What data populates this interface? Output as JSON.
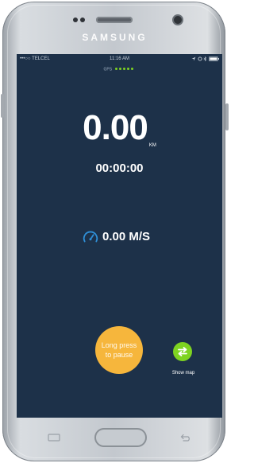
{
  "device": {
    "brand": "SAMSUNG"
  },
  "status_bar": {
    "carrier": "•••○○ TELCEL",
    "time": "11:16 AM"
  },
  "gps": {
    "label": "GPS",
    "signal_level_of_5": 5
  },
  "distance": {
    "value": "0.00",
    "unit": "KM"
  },
  "elapsed_time": "00:00:00",
  "speed": {
    "value": "0.00 M/S"
  },
  "pause_button": {
    "label": "Long press to pause"
  },
  "map_button": {
    "label": "Show map"
  },
  "colors": {
    "screen_bg": "#1d3149",
    "pause_accent": "#f6b63c",
    "map_accent": "#7ed321",
    "speed_icon": "#2f8fd6"
  }
}
